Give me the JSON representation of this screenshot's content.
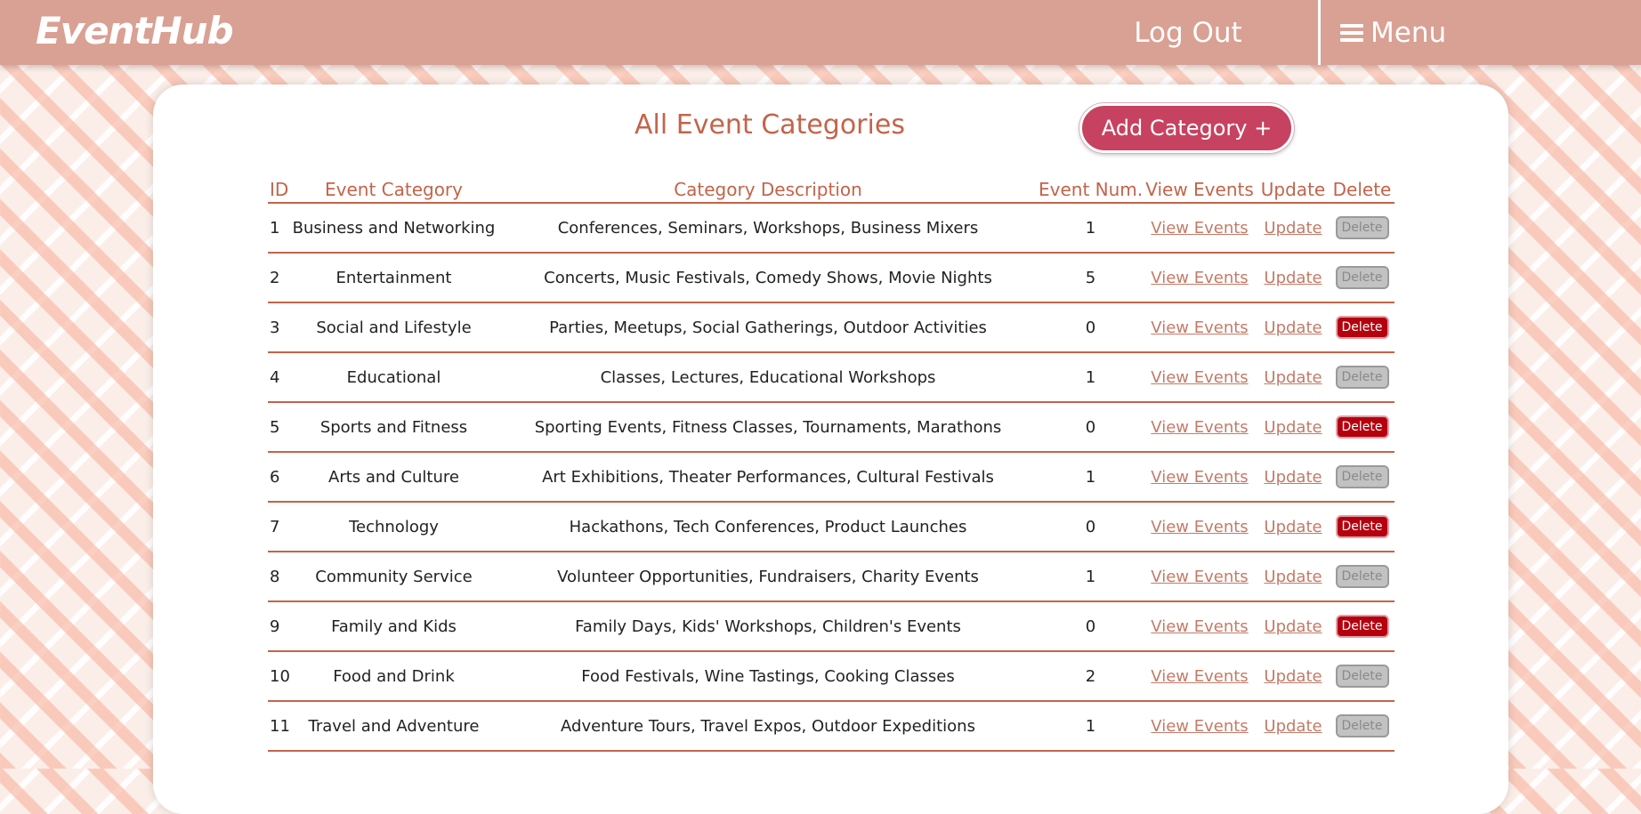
{
  "header": {
    "brand": "EventHub",
    "logout_label": "Log Out",
    "menu_label": "Menu"
  },
  "main": {
    "title": "All Event Categories",
    "add_button_label": "Add Category +"
  },
  "table": {
    "columns": [
      "ID",
      "Event Category",
      "Category Description",
      "Event Num.",
      "View Events",
      "Update",
      "Delete"
    ],
    "rows": [
      {
        "id": "1",
        "category": "Business and Networking",
        "description": "Conferences, Seminars, Workshops, Business Mixers",
        "num": "1",
        "view": "View Events",
        "update": "Update",
        "delete": "Delete",
        "delete_enabled": false
      },
      {
        "id": "2",
        "category": "Entertainment",
        "description": "Concerts, Music Festivals, Comedy Shows, Movie Nights",
        "num": "5",
        "view": "View Events",
        "update": "Update",
        "delete": "Delete",
        "delete_enabled": false
      },
      {
        "id": "3",
        "category": "Social and Lifestyle",
        "description": "Parties, Meetups, Social Gatherings, Outdoor Activities",
        "num": "0",
        "view": "View Events",
        "update": "Update",
        "delete": "Delete",
        "delete_enabled": true
      },
      {
        "id": "4",
        "category": "Educational",
        "description": "Classes, Lectures, Educational Workshops",
        "num": "1",
        "view": "View Events",
        "update": "Update",
        "delete": "Delete",
        "delete_enabled": false
      },
      {
        "id": "5",
        "category": "Sports and Fitness",
        "description": "Sporting Events, Fitness Classes, Tournaments, Marathons",
        "num": "0",
        "view": "View Events",
        "update": "Update",
        "delete": "Delete",
        "delete_enabled": true
      },
      {
        "id": "6",
        "category": "Arts and Culture",
        "description": "Art Exhibitions, Theater Performances, Cultural Festivals",
        "num": "1",
        "view": "View Events",
        "update": "Update",
        "delete": "Delete",
        "delete_enabled": false
      },
      {
        "id": "7",
        "category": "Technology",
        "description": "Hackathons, Tech Conferences, Product Launches",
        "num": "0",
        "view": "View Events",
        "update": "Update",
        "delete": "Delete",
        "delete_enabled": true
      },
      {
        "id": "8",
        "category": "Community Service",
        "description": "Volunteer Opportunities, Fundraisers, Charity Events",
        "num": "1",
        "view": "View Events",
        "update": "Update",
        "delete": "Delete",
        "delete_enabled": false
      },
      {
        "id": "9",
        "category": "Family and Kids",
        "description": "Family Days, Kids' Workshops, Children's Events",
        "num": "0",
        "view": "View Events",
        "update": "Update",
        "delete": "Delete",
        "delete_enabled": true
      },
      {
        "id": "10",
        "category": "Food and Drink",
        "description": "Food Festivals, Wine Tastings, Cooking Classes",
        "num": "2",
        "view": "View Events",
        "update": "Update",
        "delete": "Delete",
        "delete_enabled": false
      },
      {
        "id": "11",
        "category": "Travel and Adventure",
        "description": "Adventure Tours, Travel Expos, Outdoor Expeditions",
        "num": "1",
        "view": "View Events",
        "update": "Update",
        "delete": "Delete",
        "delete_enabled": false
      }
    ]
  },
  "colors": {
    "header_bg": "#d9a094",
    "accent_text": "#c3644a",
    "add_button": "#c74260",
    "delete_enabled": "#b5000e",
    "delete_disabled": "#c2c2c2"
  }
}
